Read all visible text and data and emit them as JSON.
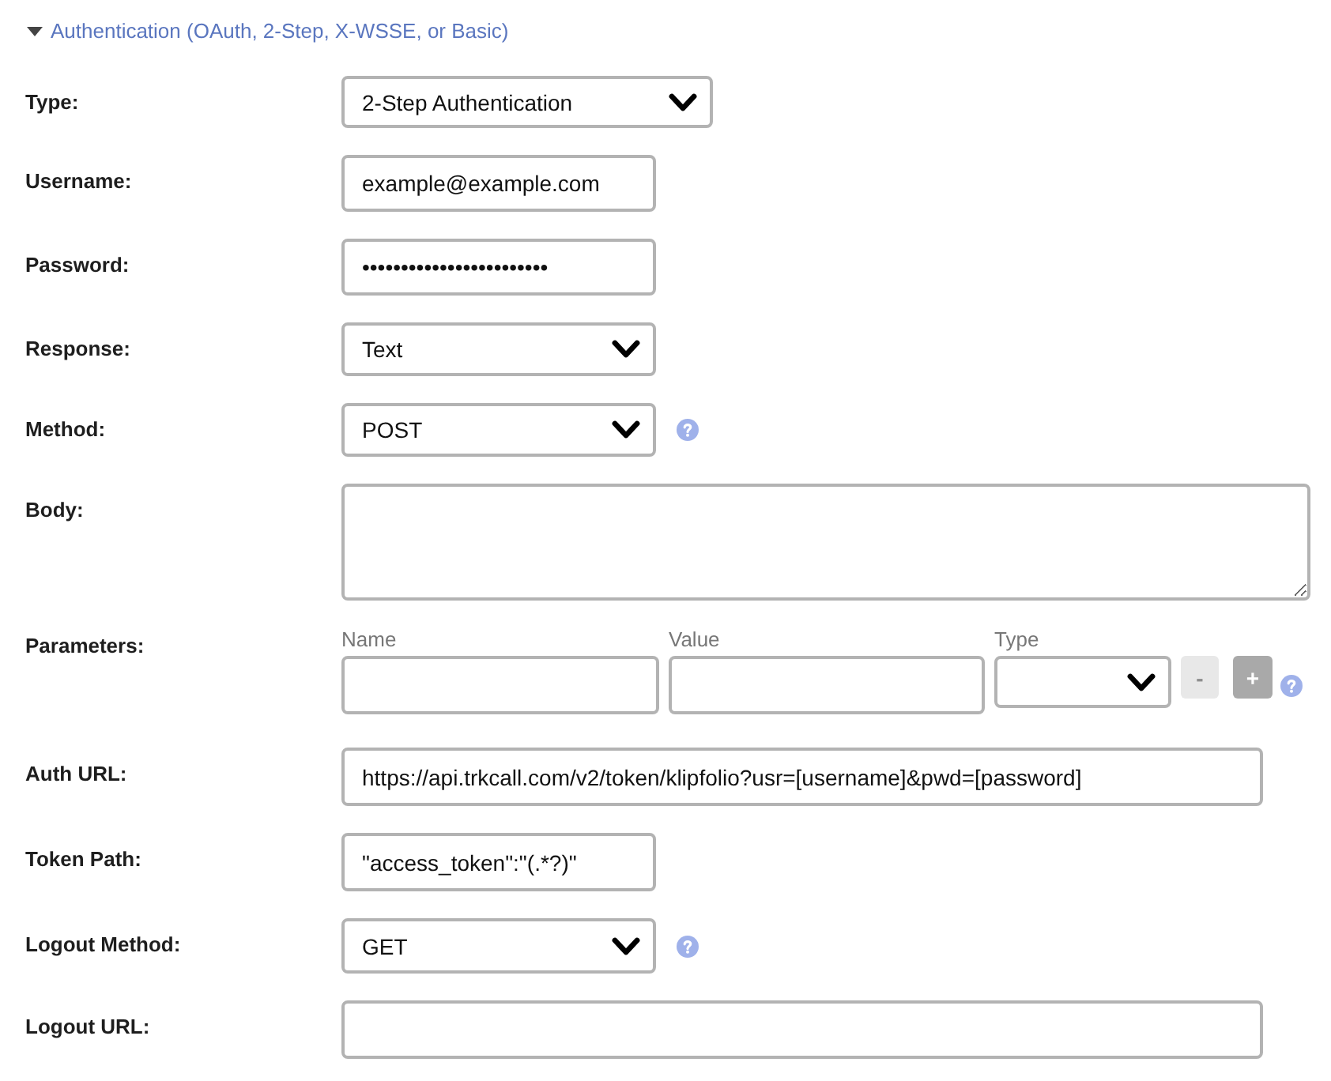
{
  "section": {
    "title": "Authentication (OAuth, 2-Step, X-WSSE, or Basic)",
    "expanded": true
  },
  "fields": [
    {
      "kind": "select",
      "label": "Type:",
      "value": "2-Step Authentication"
    },
    {
      "kind": "text",
      "label": "Username:",
      "value": "example@example.com"
    },
    {
      "kind": "text",
      "label": "Password:",
      "value": "••••••••••••••••••••••••"
    },
    {
      "kind": "select",
      "label": "Response:",
      "value": "Text"
    },
    {
      "kind": "select",
      "label": "Method:",
      "value": "POST",
      "help": true
    },
    {
      "kind": "textarea",
      "label": "Body:"
    },
    {
      "kind": "params",
      "label": "Parameters:",
      "columns": [
        {
          "heading": "Name",
          "kind": "text"
        },
        {
          "heading": "Value",
          "kind": "text"
        },
        {
          "heading": "Type",
          "kind": "select"
        }
      ],
      "buttons": [
        {
          "label": "-",
          "disabled": true
        },
        {
          "label": "+",
          "disabled": false
        }
      ],
      "help": true
    },
    {
      "kind": "text",
      "label": "Auth URL:",
      "value": "https://api.trkcall.com/v2/token/klipfolio?usr=[username]&pwd=[password]"
    },
    {
      "kind": "text",
      "label": "Token Path:",
      "value": "\"access_token\":\"(.*?)\""
    },
    {
      "kind": "select",
      "label": "Logout Method:",
      "value": "GET",
      "help": true
    },
    {
      "kind": "text",
      "label": "Logout URL:"
    }
  ]
}
